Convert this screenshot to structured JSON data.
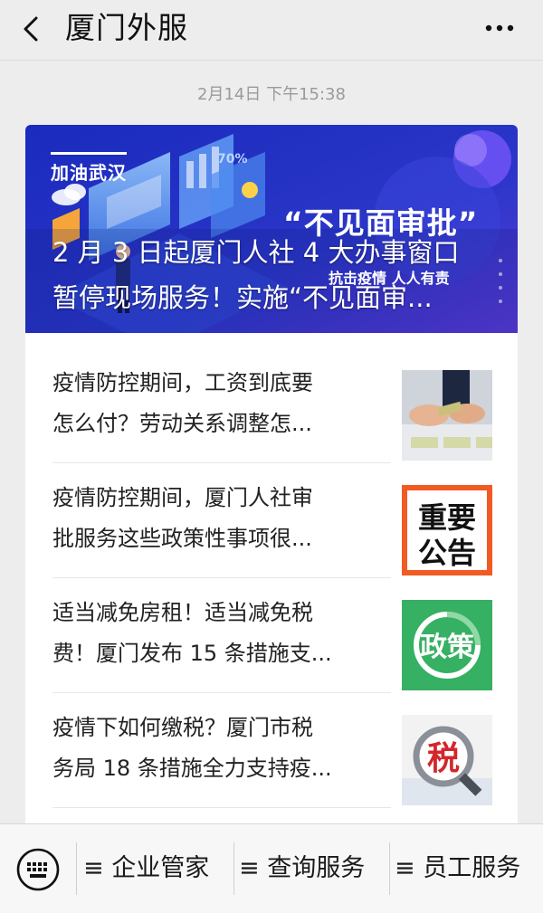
{
  "header": {
    "title": "厦门外服"
  },
  "timestamp": "2月14日 下午15:38",
  "banner": {
    "tag": "加油武汉",
    "percent": "70%",
    "slogan": "“不见面审批”",
    "sub_slogan": "抗击疫情 人人有责",
    "headline_line1": "2 月 3 日起厦门人社 4 大办事窗口",
    "headline_line2": "暂停现场服务！实施“不见面审..."
  },
  "articles": [
    {
      "line1": "疫情防控期间，工资到底要",
      "line2": "怎么付？劳动关系调整怎...",
      "icon": "money-photo"
    },
    {
      "line1": "疫情防控期间，厦门人社审",
      "line2": "批服务这些政策性事项很...",
      "icon": "notice-badge",
      "thumb_line1": "重要",
      "thumb_line2": "公告"
    },
    {
      "line1": "适当减免房租！适当减免税",
      "line2": "费！厦门发布 15 条措施支...",
      "icon": "policy-badge",
      "thumb_text": "政策"
    },
    {
      "line1": "疫情下如何缴税？厦门市税",
      "line2": "务局 18 条措施全力支持疫...",
      "icon": "tax-magnifier",
      "thumb_text": "税"
    }
  ],
  "bottom_menu": [
    {
      "label": "≡ 企业管家"
    },
    {
      "label": "≡ 查询服务"
    },
    {
      "label": "≡ 员工服务"
    }
  ],
  "colors": {
    "banner_start": "#1d2fc2",
    "banner_end": "#5a3ad6",
    "policy_green": "#36b062",
    "notice_orange": "#f15a22",
    "tax_red": "#d3272b"
  }
}
